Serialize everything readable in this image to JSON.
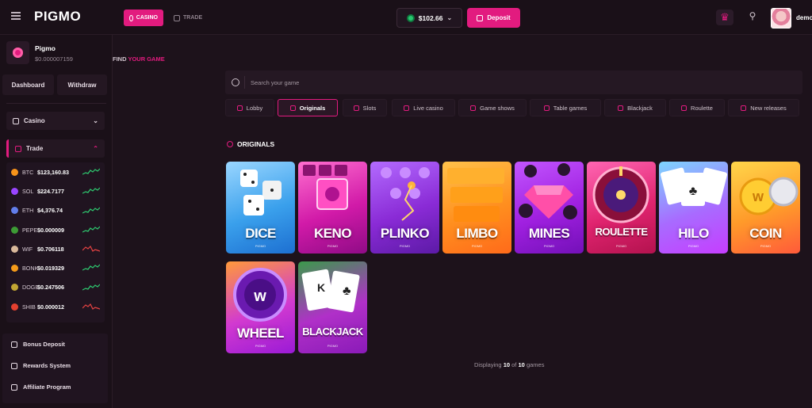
{
  "header": {
    "logo": "PIGMO",
    "nav": {
      "casino": "CASINO",
      "trade": "TRADE"
    },
    "balance": "$102.66",
    "deposit_label": "Deposit",
    "username": "demo"
  },
  "sidebar": {
    "profile": {
      "name": "Pigmo",
      "balance": "$0.000007159"
    },
    "dashboard_label": "Dashboard",
    "withdraw_label": "Withdraw",
    "casino_label": "Casino",
    "trade_label": "Trade",
    "tickers": [
      {
        "symbol": "BTC",
        "price": "$123,160.83",
        "color": "#f7931a",
        "trend": "up"
      },
      {
        "symbol": "SOL",
        "price": "$224.7177",
        "color": "#9945ff",
        "trend": "up"
      },
      {
        "symbol": "ETH",
        "price": "$4,376.74",
        "color": "#627eea",
        "trend": "up"
      },
      {
        "symbol": "PEPE",
        "price": "$0.000009",
        "color": "#3d9b35",
        "trend": "up"
      },
      {
        "symbol": "WIF",
        "price": "$0.706118",
        "color": "#d9b99b",
        "trend": "down"
      },
      {
        "symbol": "BONK",
        "price": "$0.019329",
        "color": "#f59b1a",
        "trend": "up"
      },
      {
        "symbol": "DOGE",
        "price": "$0.247506",
        "color": "#c2a633",
        "trend": "up"
      },
      {
        "symbol": "SHIB",
        "price": "$0.000012",
        "color": "#e4402f",
        "trend": "down"
      }
    ],
    "links": [
      "Bonus Deposit",
      "Rewards System",
      "Affiliate Program"
    ]
  },
  "main": {
    "find_prefix": "FIND",
    "find_highlight": "YOUR GAME",
    "search_placeholder": "Search your game",
    "tabs": [
      "Lobby",
      "Originals",
      "Slots",
      "Live casino",
      "Game shows",
      "Table games",
      "Blackjack",
      "Roulette",
      "New releases"
    ],
    "active_tab": "Originals",
    "section_title": "ORIGINALS",
    "games": [
      {
        "name": "DICE",
        "brand": "PIGMO"
      },
      {
        "name": "KENO",
        "brand": "PIGMO"
      },
      {
        "name": "PLINKO",
        "brand": "PIGMO"
      },
      {
        "name": "LIMBO",
        "brand": "PIGMO"
      },
      {
        "name": "MINES",
        "brand": "PIGMO"
      },
      {
        "name": "ROULETTE",
        "brand": "PIGMO"
      },
      {
        "name": "HILO",
        "brand": "PIGMO"
      },
      {
        "name": "COIN",
        "brand": "PIGMO"
      },
      {
        "name": "WHEEL",
        "brand": "PIGMO"
      },
      {
        "name": "BLACKJACK",
        "brand": "PIGMO"
      }
    ],
    "display": {
      "prefix": "Displaying",
      "shown": "10",
      "mid": "of",
      "total": "10",
      "suffix": "games"
    }
  }
}
